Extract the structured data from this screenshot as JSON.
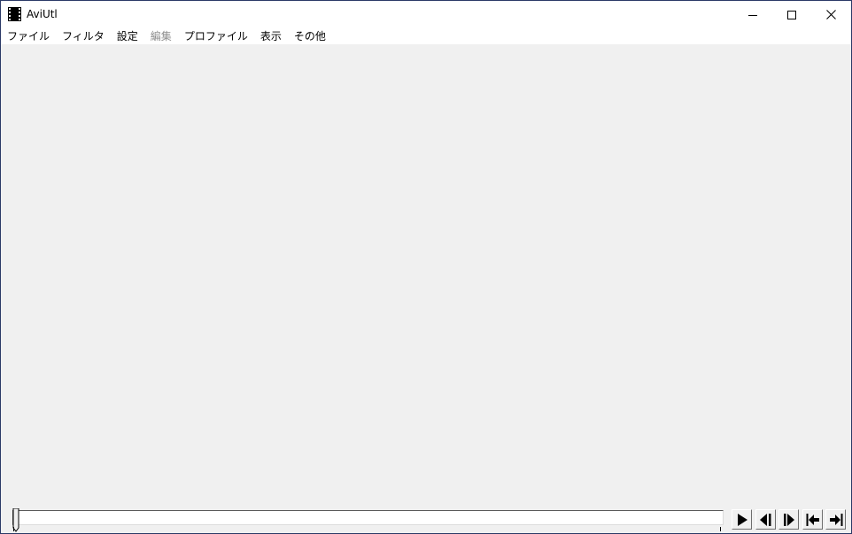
{
  "window": {
    "title": "AviUtl",
    "app_icon": "film-icon",
    "controls": {
      "minimize_icon": "minimize-icon",
      "maximize_icon": "maximize-icon",
      "close_icon": "close-icon"
    }
  },
  "menubar": {
    "items": [
      {
        "label": "ファイル",
        "enabled": true
      },
      {
        "label": "フィルタ",
        "enabled": true
      },
      {
        "label": "設定",
        "enabled": true
      },
      {
        "label": "編集",
        "enabled": false
      },
      {
        "label": "プロファイル",
        "enabled": true
      },
      {
        "label": "表示",
        "enabled": true
      },
      {
        "label": "その他",
        "enabled": true
      }
    ]
  },
  "playback": {
    "buttons": [
      {
        "name": "play-button",
        "icon": "play-icon"
      },
      {
        "name": "prev-frame-button",
        "icon": "prev-frame-icon"
      },
      {
        "name": "next-frame-button",
        "icon": "next-frame-icon"
      },
      {
        "name": "first-frame-button",
        "icon": "first-frame-icon"
      },
      {
        "name": "last-frame-button",
        "icon": "last-frame-icon"
      }
    ]
  },
  "colors": {
    "client_background": "#f0f0f0",
    "titlebar_background": "#ffffff",
    "window_border": "#2b3a67",
    "disabled_text": "#8d8d8d"
  }
}
